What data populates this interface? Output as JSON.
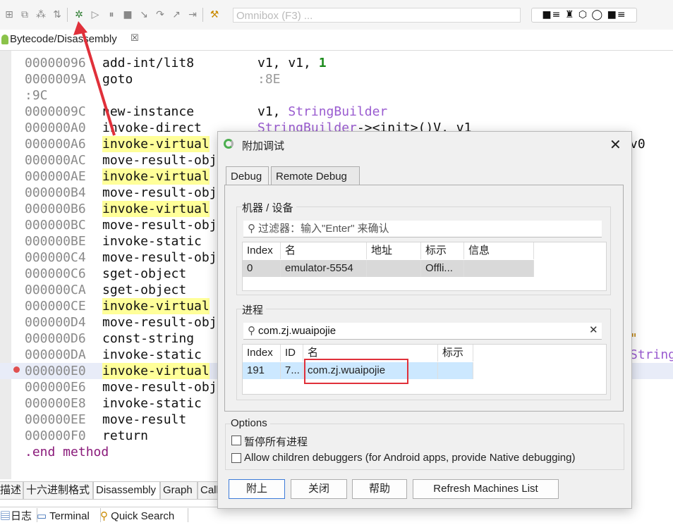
{
  "toolbar": {
    "icons": [
      "grid-icon",
      "modules-icon",
      "graph-icon",
      "sort-icon",
      "debug-icon",
      "run-icon",
      "pause-icon",
      "stop-icon",
      "step-into-icon",
      "step-over-icon",
      "step-out-icon",
      "run-to-cursor-icon",
      "build-icon"
    ],
    "omnibox_placeholder": "Omnibox (F3) ...",
    "right_widget": "■≡ ♜ ⬡ ◯ ■≡"
  },
  "editor_tab": {
    "title": "Bytecode/Disassembly",
    "close": "☒"
  },
  "code": {
    "lines": [
      {
        "addr": "00000096",
        "ins": "add-int/lit8",
        "hl": false,
        "ops": [
          {
            "t": "v1, v1, ",
            "c": "reg"
          },
          {
            "t": "1",
            "c": "num"
          }
        ]
      },
      {
        "addr": "0000009A",
        "ins": "goto",
        "hl": false,
        "ops": [
          {
            "t": ":8E",
            "c": "lbl"
          }
        ]
      },
      {
        "label": ":9C"
      },
      {
        "addr": "0000009C",
        "ins": "new-instance",
        "hl": false,
        "ops": [
          {
            "t": "v1, ",
            "c": "reg"
          },
          {
            "t": "StringBuilder",
            "c": "cls"
          }
        ]
      },
      {
        "addr": "000000A0",
        "ins": "invoke-direct",
        "hl": false,
        "ops": [
          {
            "t": "StringBuilder",
            "c": "cls"
          },
          {
            "t": "-><init>()V, v1",
            "c": "reg"
          }
        ]
      },
      {
        "addr": "000000A6",
        "ins": "invoke-virtual",
        "hl": true,
        "ops": [],
        "tail": "v0"
      },
      {
        "addr": "000000AC",
        "ins": "move-result-obj",
        "hl": false,
        "ops": []
      },
      {
        "addr": "000000AE",
        "ins": "invoke-virtual",
        "hl": true,
        "ops": []
      },
      {
        "addr": "000000B4",
        "ins": "move-result-obj",
        "hl": false,
        "ops": []
      },
      {
        "addr": "000000B6",
        "ins": "invoke-virtual",
        "hl": true,
        "ops": []
      },
      {
        "addr": "000000BC",
        "ins": "move-result-obj",
        "hl": false,
        "ops": []
      },
      {
        "addr": "000000BE",
        "ins": "invoke-static",
        "hl": false,
        "ops": []
      },
      {
        "addr": "000000C4",
        "ins": "move-result-obj",
        "hl": false,
        "ops": []
      },
      {
        "addr": "000000C6",
        "ins": "sget-object",
        "hl": false,
        "ops": []
      },
      {
        "addr": "000000CA",
        "ins": "sget-object",
        "hl": false,
        "ops": []
      },
      {
        "addr": "000000CE",
        "ins": "invoke-virtual",
        "hl": true,
        "ops": []
      },
      {
        "addr": "000000D4",
        "ins": "move-result-obj",
        "hl": false,
        "ops": []
      },
      {
        "addr": "000000D6",
        "ins": "const-string",
        "hl": false,
        "ops": [],
        "tail": "\""
      },
      {
        "addr": "000000DA",
        "ins": "invoke-static",
        "hl": false,
        "ops": [],
        "tail": "String"
      },
      {
        "addr": "000000E0",
        "ins": "invoke-virtual",
        "hl": true,
        "ops": [],
        "selected": true
      },
      {
        "addr": "000000E6",
        "ins": "move-result-obj",
        "hl": false,
        "ops": []
      },
      {
        "addr": "000000E8",
        "ins": "invoke-static",
        "hl": false,
        "ops": []
      },
      {
        "addr": "000000EE",
        "ins": "move-result",
        "hl": false,
        "ops": []
      },
      {
        "addr": "000000F0",
        "ins": "return",
        "hl": false,
        "ops": []
      },
      {
        "end": ".end method"
      }
    ]
  },
  "bottom_tabs": [
    "描述",
    "十六进制格式",
    "Disassembly",
    "Graph",
    "Call"
  ],
  "bottom_tabs2": [
    "日志",
    "Terminal",
    "Quick Search"
  ],
  "dialog": {
    "title": "附加调试",
    "close": "✕",
    "tabs": [
      "Debug",
      "Remote Debug"
    ],
    "machines": {
      "label": "机器 / 设备",
      "filter": "过滤器：输入\"Enter\" 来确认",
      "columns": [
        "Index",
        "名",
        "地址",
        "标示",
        "信息"
      ],
      "rows": [
        [
          "0",
          "emulator-5554",
          "",
          "Offli...",
          ""
        ]
      ]
    },
    "processes": {
      "label": "进程",
      "filter": "com.zj.wuaipojie",
      "columns": [
        "Index",
        "ID",
        "名",
        "标示"
      ],
      "rows": [
        [
          "191",
          "7...",
          "com.zj.wuaipojie",
          ""
        ]
      ]
    },
    "options": {
      "label": "Options",
      "suspend_all": "暂停所有进程",
      "allow_children": "Allow children debuggers (for Android apps, provide Native debugging)"
    },
    "buttons": {
      "attach": "附上",
      "close": "关闭",
      "help": "帮助",
      "refresh": "Refresh Machines List"
    }
  },
  "colors": {
    "highlight": "#ffff99",
    "accent_red": "#e0303a",
    "selection_blue": "#cce8ff"
  }
}
